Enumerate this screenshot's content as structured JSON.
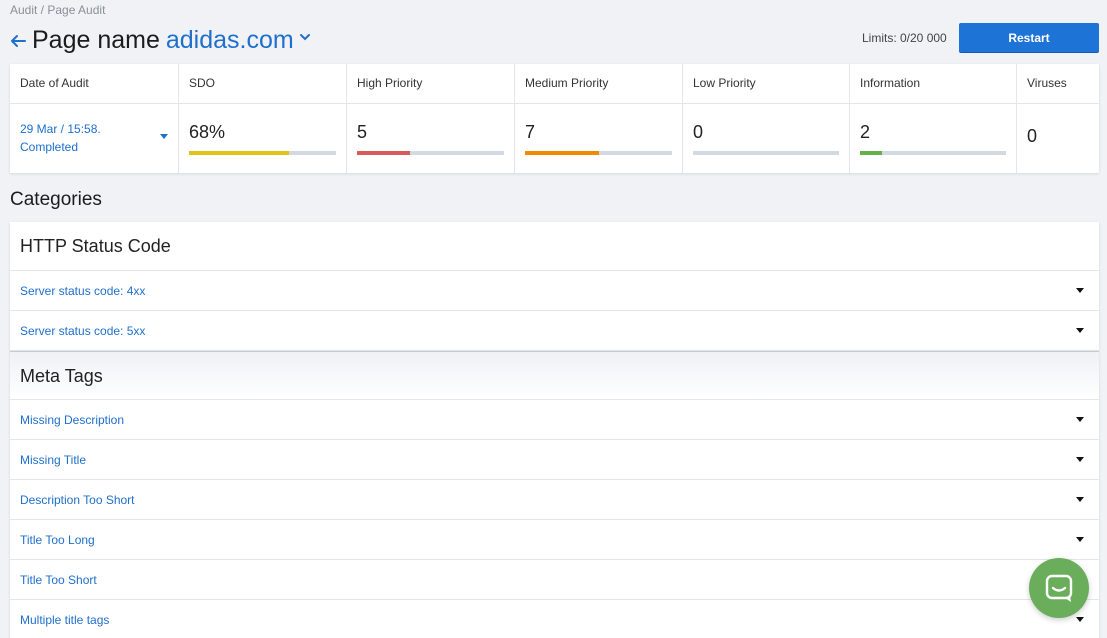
{
  "breadcrumb": "Audit / Page Audit",
  "header": {
    "title_label": "Page name",
    "domain": "adidas.com",
    "limits": "Limits: 0/20 000",
    "restart_label": "Restart"
  },
  "stats": {
    "date": {
      "label": "Date of Audit",
      "line1": "29 Mar / 15:58.",
      "line2": "Completed"
    },
    "columns": [
      {
        "label": "SDO",
        "value": "68%",
        "fill": 0.68,
        "color": "#e0c21a"
      },
      {
        "label": "High Priority",
        "value": "5",
        "fill": 0.36,
        "color": "#d95a5a"
      },
      {
        "label": "Medium Priority",
        "value": "7",
        "fill": 0.5,
        "color": "#f08a00"
      },
      {
        "label": "Low Priority",
        "value": "0",
        "fill": 0,
        "color": "#9aa3ad"
      },
      {
        "label": "Information",
        "value": "2",
        "fill": 0.15,
        "color": "#66b04c"
      }
    ],
    "viruses": {
      "label": "Viruses",
      "value": "0"
    }
  },
  "categories_title": "Categories",
  "categories": [
    {
      "title": "HTTP Status Code",
      "items": [
        "Server status code: 4xx",
        "Server status code: 5xx"
      ]
    },
    {
      "title": "Meta Tags",
      "items": [
        "Missing Description",
        "Missing Title",
        "Description Too Short",
        "Title Too Long",
        "Title Too Short",
        "Multiple title tags"
      ]
    }
  ],
  "colors": {
    "accent": "#1f6fcc",
    "button": "#1e73d6",
    "chat": "#6aae5c"
  },
  "icons": {
    "back": "arrow-left-icon",
    "domain_menu": "chevron-down-icon",
    "chat": "chat-icon"
  }
}
